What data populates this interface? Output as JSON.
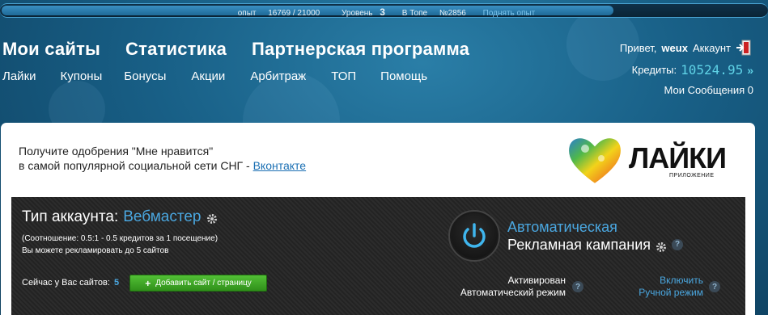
{
  "xp": {
    "label": "опыт",
    "value": "16769 / 21000",
    "level_label": "Уровень",
    "level": "3",
    "top_label": "В Топе",
    "top_rank": "№2856",
    "boost_link": "Поднять опыт",
    "progress": 0.8
  },
  "nav": {
    "main": [
      "Мои сайты",
      "Статистика",
      "Партнерская программа"
    ],
    "sub": [
      "Лайки",
      "Купоны",
      "Бонусы",
      "Акции",
      "Арбитраж",
      "ТОП",
      "Помощь"
    ]
  },
  "user": {
    "greeting": "Привет,",
    "username": "weux",
    "account_link": "Аккаунт",
    "exit_icon": "exit-door-icon",
    "credits_label": "Кредиты:",
    "credits_value": "10524.95",
    "credits_arrow": "»",
    "messages": "Мои Сообщения 0"
  },
  "promo": {
    "line1": "Получите одобрения \"Мне нравится\"",
    "line2": "в самой популярной социальной сети СНГ -",
    "link": "Вконтакте"
  },
  "logo": {
    "title": "ЛАЙКИ",
    "subtitle": "ПРИЛОЖЕНИЕ"
  },
  "account": {
    "type_label": "Тип аккаунта:",
    "type_value": "Вебмастер",
    "ratio_note": "(Соотношение: 0.5:1 - 0.5 кредитов за 1 посещение)",
    "limit_note": "Вы можете рекламировать до 5 сайтов",
    "sites_label": "Сейчас у Вас сайтов:",
    "sites_count": "5",
    "add_button": "Добавить сайт / страницу"
  },
  "campaign": {
    "title_blue": "Автоматическая",
    "title_white": "Рекламная кампания",
    "state_line1": "Активирован",
    "state_line2": "Автоматический режим",
    "manual_line1": "Включить",
    "manual_line2": "Ручной режим",
    "help_glyph": "?"
  },
  "colors": {
    "accent_blue": "#4aa7e0",
    "credits": "#5fd2e6",
    "button_green": "#3aa524",
    "background": "#185f86"
  }
}
